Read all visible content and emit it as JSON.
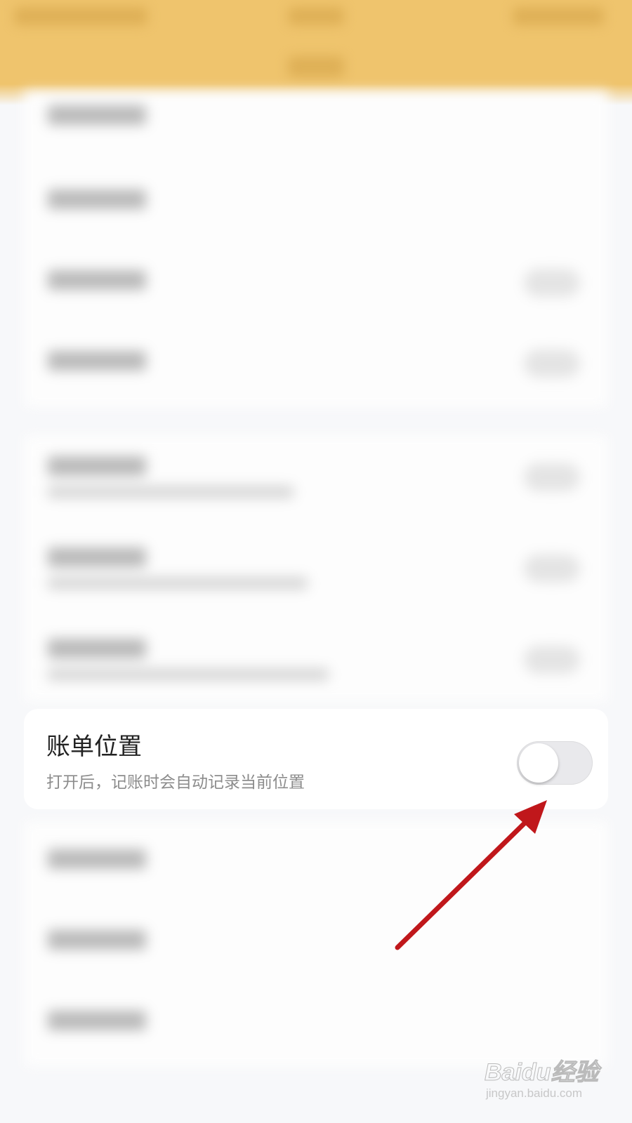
{
  "setting": {
    "title": "账单位置",
    "description": "打开后，记账时会自动记录当前位置",
    "toggle_on": false
  },
  "colors": {
    "header": "#efc46d",
    "arrow": "#c0171b",
    "toggle_off": "#e9e9ec"
  },
  "watermark": {
    "logo": "Baidu经验",
    "url": "jingyan.baidu.com"
  }
}
